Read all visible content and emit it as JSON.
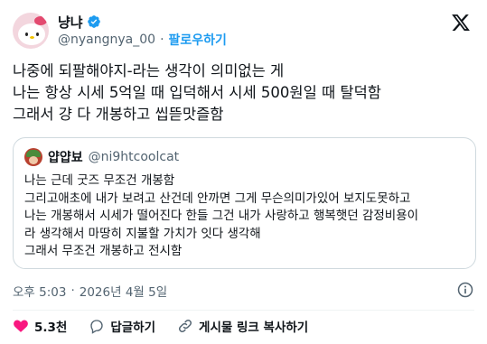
{
  "author": {
    "display_name": "냥냐",
    "handle": "@nyangnya_00",
    "separator": "·",
    "follow_label": "팔로우하기"
  },
  "tweet": {
    "text": "나중에 되팔해야지-라는 생각이 의미없는 게\n나는 항상 시세 5억일 때 입덕해서 시세 500원일 때 탈덕함\n그래서 걍 다 개봉하고 씹뜯맛즐함"
  },
  "quoted": {
    "display_name": "얍얍뵤",
    "handle": "@ni9htcoolcat",
    "text": "나는 근데 굿즈 무조건 개봉함\n그리고애초에 내가 보려고 산건데 안까면 그게 무슨의미가있어 보지도못하고\n나는 개봉해서 시세가 떨어진다 한들 그건 내가 사랑하고 행복햇던 감정비용이\n라 생각해서 마땅히 지불할 가치가 잇다 생각해\n그래서 무조건 개봉하고 전시함"
  },
  "meta": {
    "time": "오후 5:03",
    "separator": "·",
    "date": "2026년 4월 5일"
  },
  "actions": {
    "like_count": "5.3천",
    "reply_label": "답글하기",
    "copy_link_label": "게시물 링크 복사하기"
  },
  "colors": {
    "accent": "#1d9bf0",
    "like": "#f91880",
    "text": "#0f1419",
    "secondary": "#536471",
    "border": "#cfd9de"
  },
  "icons": {
    "verified": "verified-badge-icon",
    "logo": "x-logo-icon",
    "info": "info-icon",
    "like": "heart-icon",
    "reply": "reply-bubble-icon",
    "link": "link-icon"
  }
}
